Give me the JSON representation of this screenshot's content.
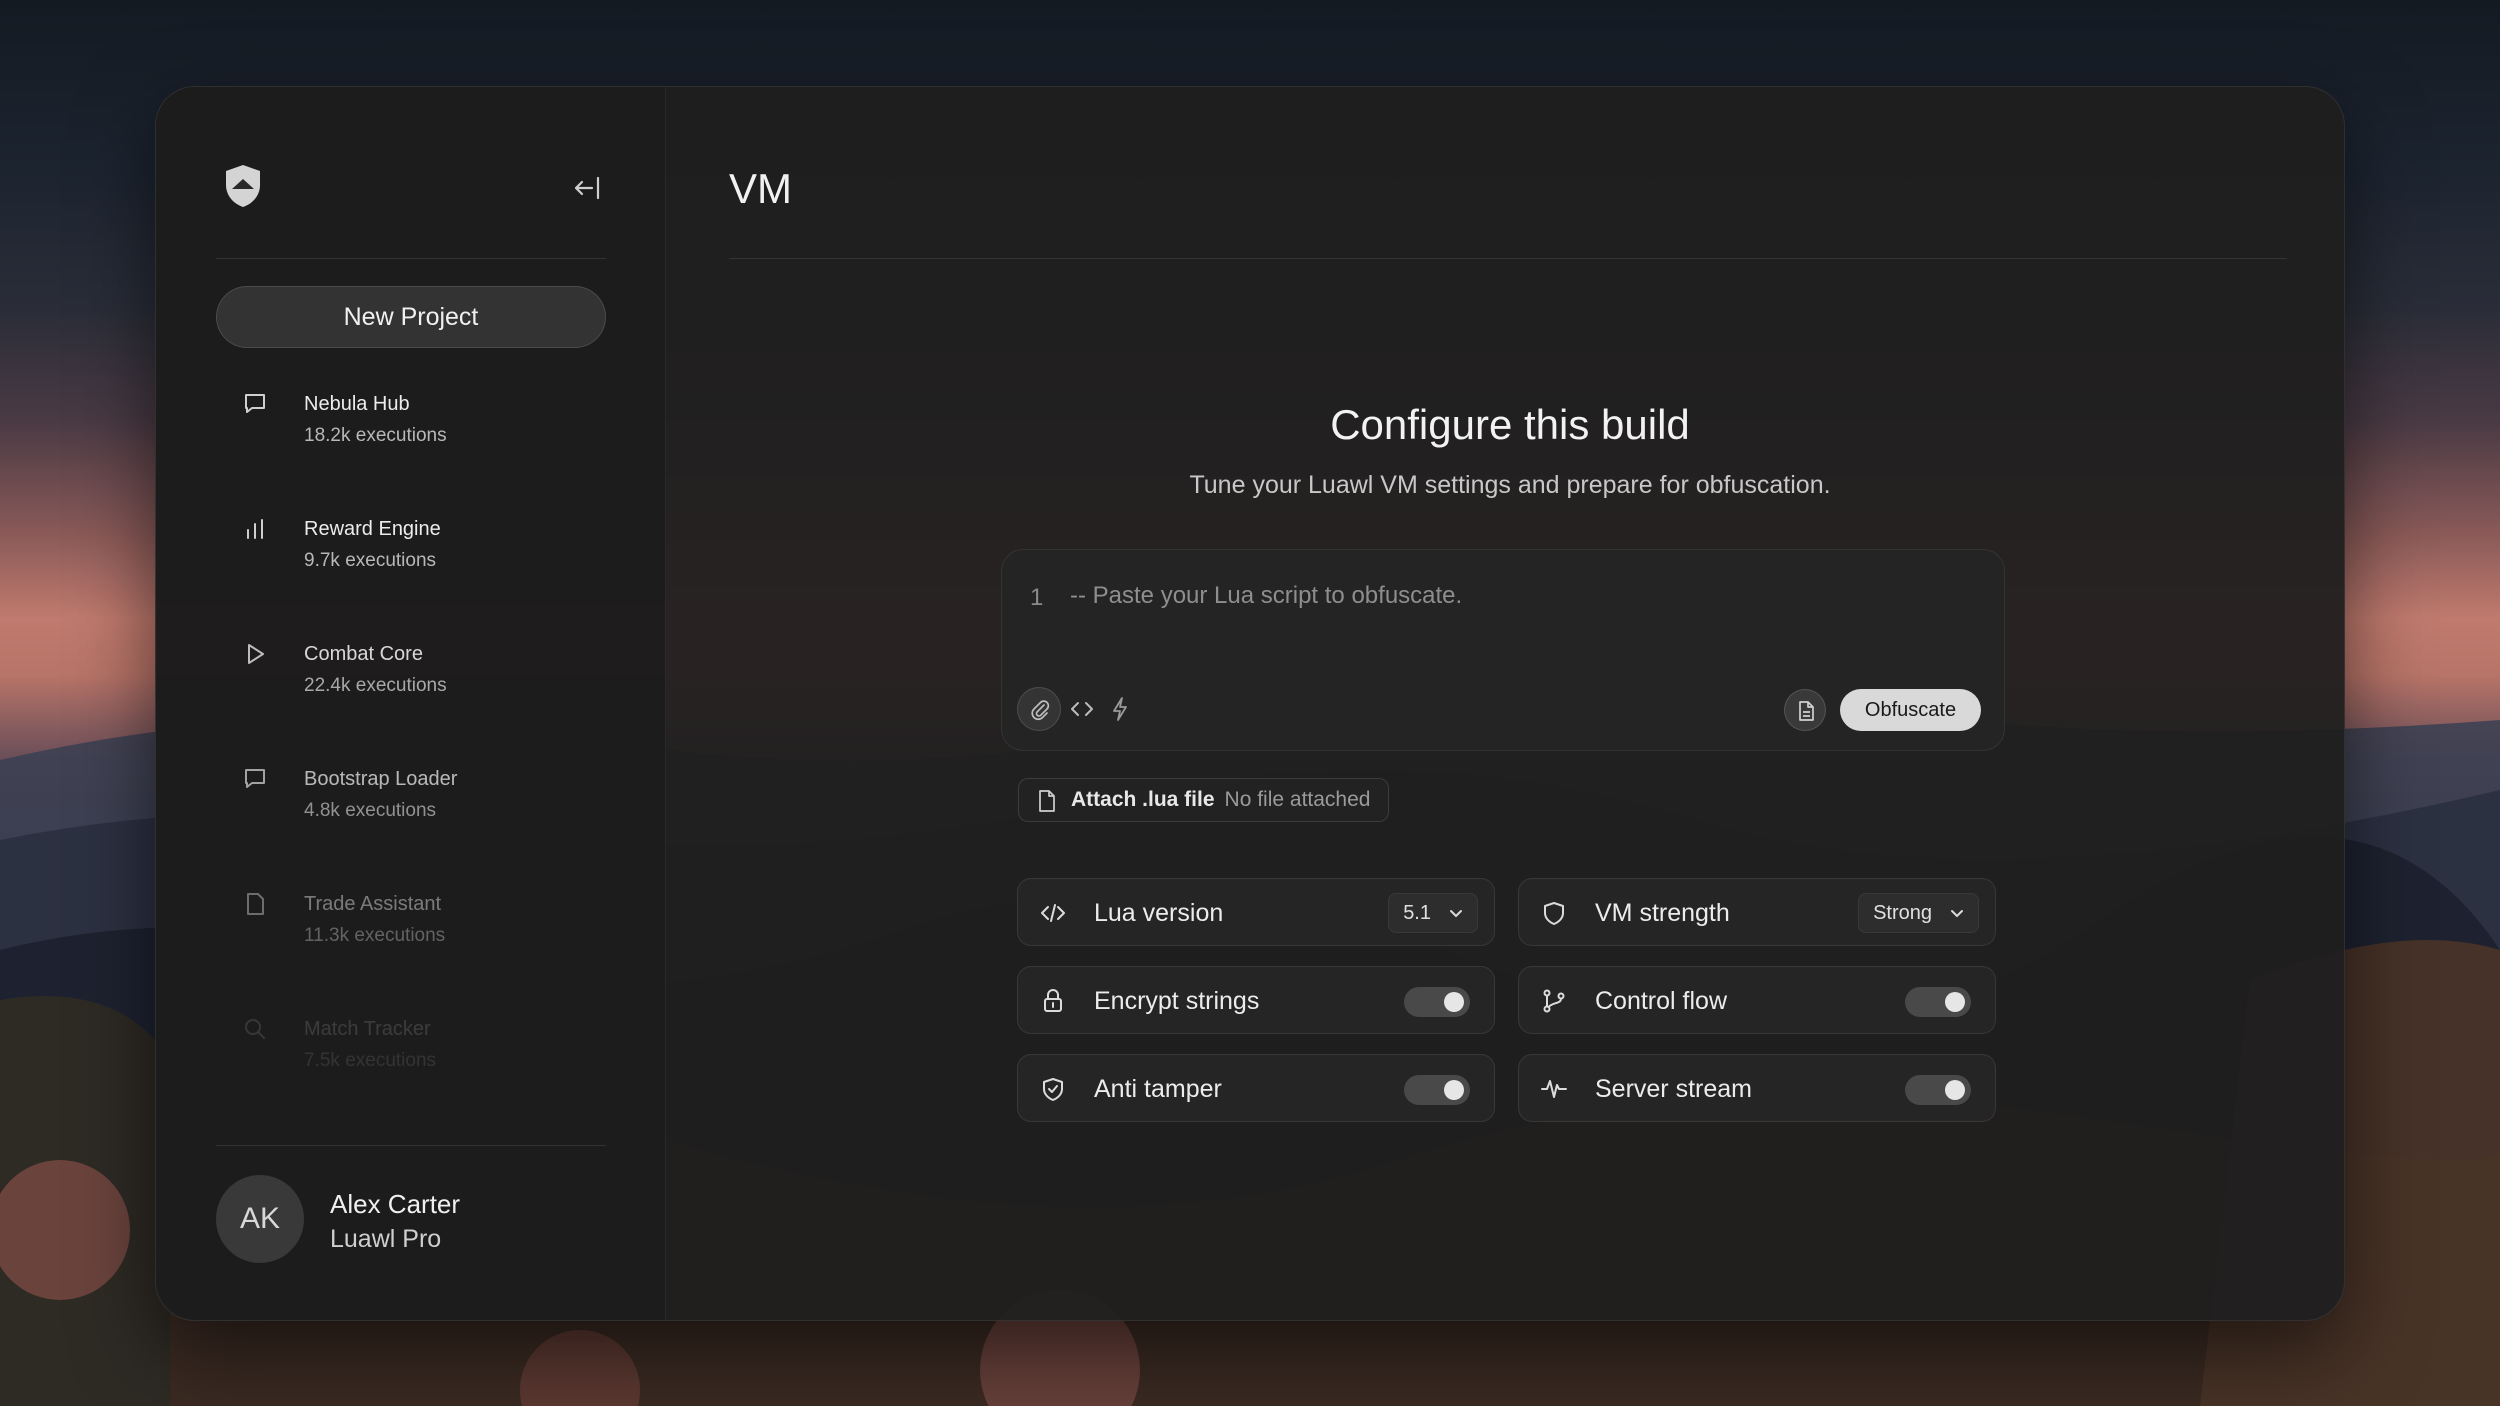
{
  "header": {
    "title": "VM"
  },
  "sidebar": {
    "new_project_label": "New Project",
    "projects": [
      {
        "name": "Nebula Hub",
        "executions": "18.2k executions",
        "icon": "chat-bubble-icon"
      },
      {
        "name": "Reward Engine",
        "executions": "9.7k executions",
        "icon": "bar-chart-icon"
      },
      {
        "name": "Combat Core",
        "executions": "22.4k executions",
        "icon": "play-icon"
      },
      {
        "name": "Bootstrap Loader",
        "executions": "4.8k executions",
        "icon": "chat-bubble-icon"
      },
      {
        "name": "Trade Assistant",
        "executions": "11.3k executions",
        "icon": "document-icon"
      },
      {
        "name": "Match Tracker",
        "executions": "7.5k executions",
        "icon": "search-icon"
      }
    ],
    "user": {
      "initials": "AK",
      "name": "Alex Carter",
      "plan": "Luawl Pro"
    }
  },
  "main": {
    "config_title": "Configure this build",
    "config_subtitle": "Tune your Luawl VM settings and prepare for obfuscation.",
    "editor": {
      "line_number": "1",
      "placeholder": "-- Paste your Lua script to obfuscate.",
      "value": "",
      "obfuscate_label": "Obfuscate"
    },
    "attach": {
      "label": "Attach .lua file",
      "status": "No file attached"
    },
    "settings": {
      "lua_version": {
        "label": "Lua version",
        "value": "5.1",
        "icon": "code-icon"
      },
      "vm_strength": {
        "label": "VM strength",
        "value": "Strong",
        "icon": "shield-icon"
      },
      "encrypt_strings": {
        "label": "Encrypt strings",
        "enabled": true,
        "icon": "lock-icon"
      },
      "control_flow": {
        "label": "Control flow",
        "enabled": true,
        "icon": "git-branch-icon"
      },
      "anti_tamper": {
        "label": "Anti tamper",
        "enabled": true,
        "icon": "shield-check-icon"
      },
      "server_stream": {
        "label": "Server stream",
        "enabled": true,
        "icon": "activity-icon"
      }
    }
  }
}
